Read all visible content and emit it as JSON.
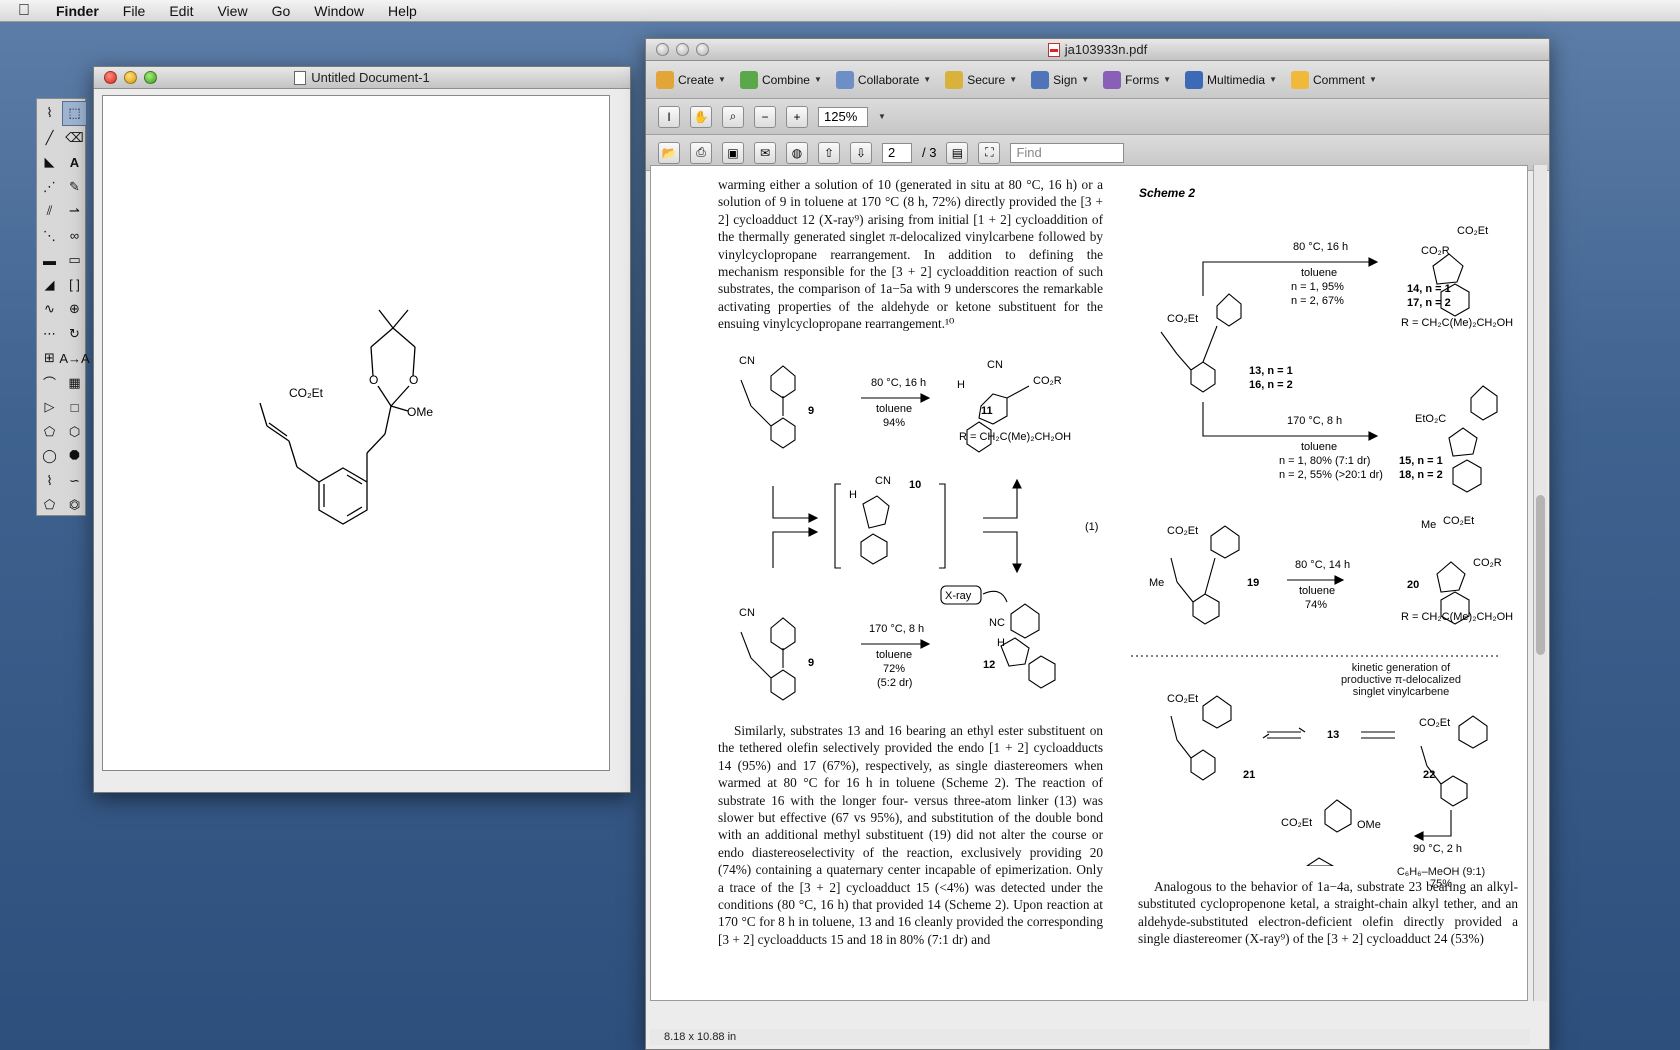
{
  "menubar": {
    "app": "Finder",
    "items": [
      "File",
      "Edit",
      "View",
      "Go",
      "Window",
      "Help"
    ]
  },
  "untitled_window": {
    "title": "Untitled Document-1",
    "molecule_labels": {
      "ester": "CO₂Et",
      "methoxy": "OMe",
      "o1": "O",
      "o2": "O"
    }
  },
  "pdf_window": {
    "title": "ja103933n.pdf",
    "toolbar": [
      "Create",
      "Combine",
      "Collaborate",
      "Secure",
      "Sign",
      "Forms",
      "Multimedia",
      "Comment"
    ],
    "zoom": "125%",
    "page_current": "2",
    "page_total": "/ 3",
    "find_placeholder": "Find",
    "status": "8.18 x 10.88 in",
    "left_para1": "warming either a solution of 10 (generated in situ at 80 °C, 16 h) or a solution of 9 in toluene at 170 °C (8 h, 72%) directly provided the [3 + 2] cycloadduct 12 (X-ray⁹) arising from initial [1 + 2] cycloaddition of the thermally generated singlet π-delocalized vinylcarbene followed by vinylcyclopropane rearrangement. In addition to defining the mechanism responsible for the [3 + 2] cycloaddition reaction of such substrates, the comparison of 1a−5a with 9 underscores the remarkable activating properties of the aldehyde or ketone substituent for the ensuing vinylcyclopropane rearrangement.¹⁰",
    "left_para2": "Similarly, substrates 13 and 16 bearing an ethyl ester substituent on the tethered olefin selectively provided the endo [1 + 2] cycloadducts 14 (95%) and 17 (67%), respectively, as single diastereomers when warmed at 80 °C for 16 h in toluene (Scheme 2). The reaction of substrate 16 with the longer four- versus three-atom linker (13) was slower but effective (67 vs 95%), and substitution of the double bond with an additional methyl substituent (19) did not alter the course or endo diastereoselectivity of the reaction, exclusively providing 20 (74%) containing a quaternary center incapable of epimerization. Only a trace of the [3 + 2] cycloadduct 15 (<4%) was detected under the conditions (80 °C, 16 h) that provided 14 (Scheme 2). Upon reaction at 170 °C for 8 h in toluene, 13 and 16 cleanly provided the corresponding [3 + 2] cycloadducts 15 and 18 in 80% (7:1 dr) and",
    "right_para": "Analogous to the behavior of 1a−4a, substrate 23 bearing an alkyl-substituted cyclopropenone ketal, a straight-chain alkyl tether, and an aldehyde-substituted electron-deficient olefin directly provided a single diastereomer (X-ray⁹) of the [3 + 2] cycloadduct 24 (53%)",
    "scheme_title": "Scheme 2",
    "eq_label": "(1)",
    "eq1": {
      "cond1": "80 °C, 16 h",
      "solv1": "toluene",
      "yield1": "94%",
      "cmpd9": "9",
      "cmpd11": "11",
      "R_def": "R = CH₂C(Me)₂CH₂OH",
      "cmpd10": "10",
      "cond2": "170 °C, 8 h",
      "solv2": "toluene",
      "yield2": "72%",
      "dr2": "(5:2 dr)",
      "cmpd12": "12",
      "xray": "X-ray",
      "cn": "CN",
      "co2r": "CO₂R",
      "h": "H",
      "nc": "NC",
      "o": "O"
    },
    "scheme2": {
      "a_cond": "80 °C, 16 h",
      "a_solv": "toluene",
      "a_y1": "n = 1, 95%",
      "a_y2": "n = 2, 67%",
      "p14": "14, n = 1",
      "p17": "17, n = 2",
      "R1": "R = CH₂C(Me)₂CH₂OH",
      "s13": "13, n = 1",
      "s16": "16, n = 2",
      "b_cond": "170 °C, 8 h",
      "b_solv": "toluene",
      "b_y1": "n = 1, 80% (7:1 dr)",
      "b_y2": "n = 2, 55% (>20:1 dr)",
      "p15": "15, n = 1",
      "p18": "18, n = 2",
      "eto2c": "EtO₂C",
      "c_cond": "80 °C, 14 h",
      "c_solv": "toluene",
      "c_yield": "74%",
      "s19": "19",
      "p20": "20",
      "R2": "R = CH₂C(Me)₂CH₂OH",
      "me": "Me",
      "co2et": "CO₂Et",
      "co2r": "CO₂R",
      "kinetic": "kinetic generation of productive π-delocalized singlet vinylcarbene",
      "c21": "21",
      "c13": "13",
      "c22": "22",
      "d_cond": "90 °C, 2 h",
      "d_solv": "C₆H₆–MeOH (9:1)",
      "d_yield": "75%",
      "ome": "OMe"
    }
  }
}
